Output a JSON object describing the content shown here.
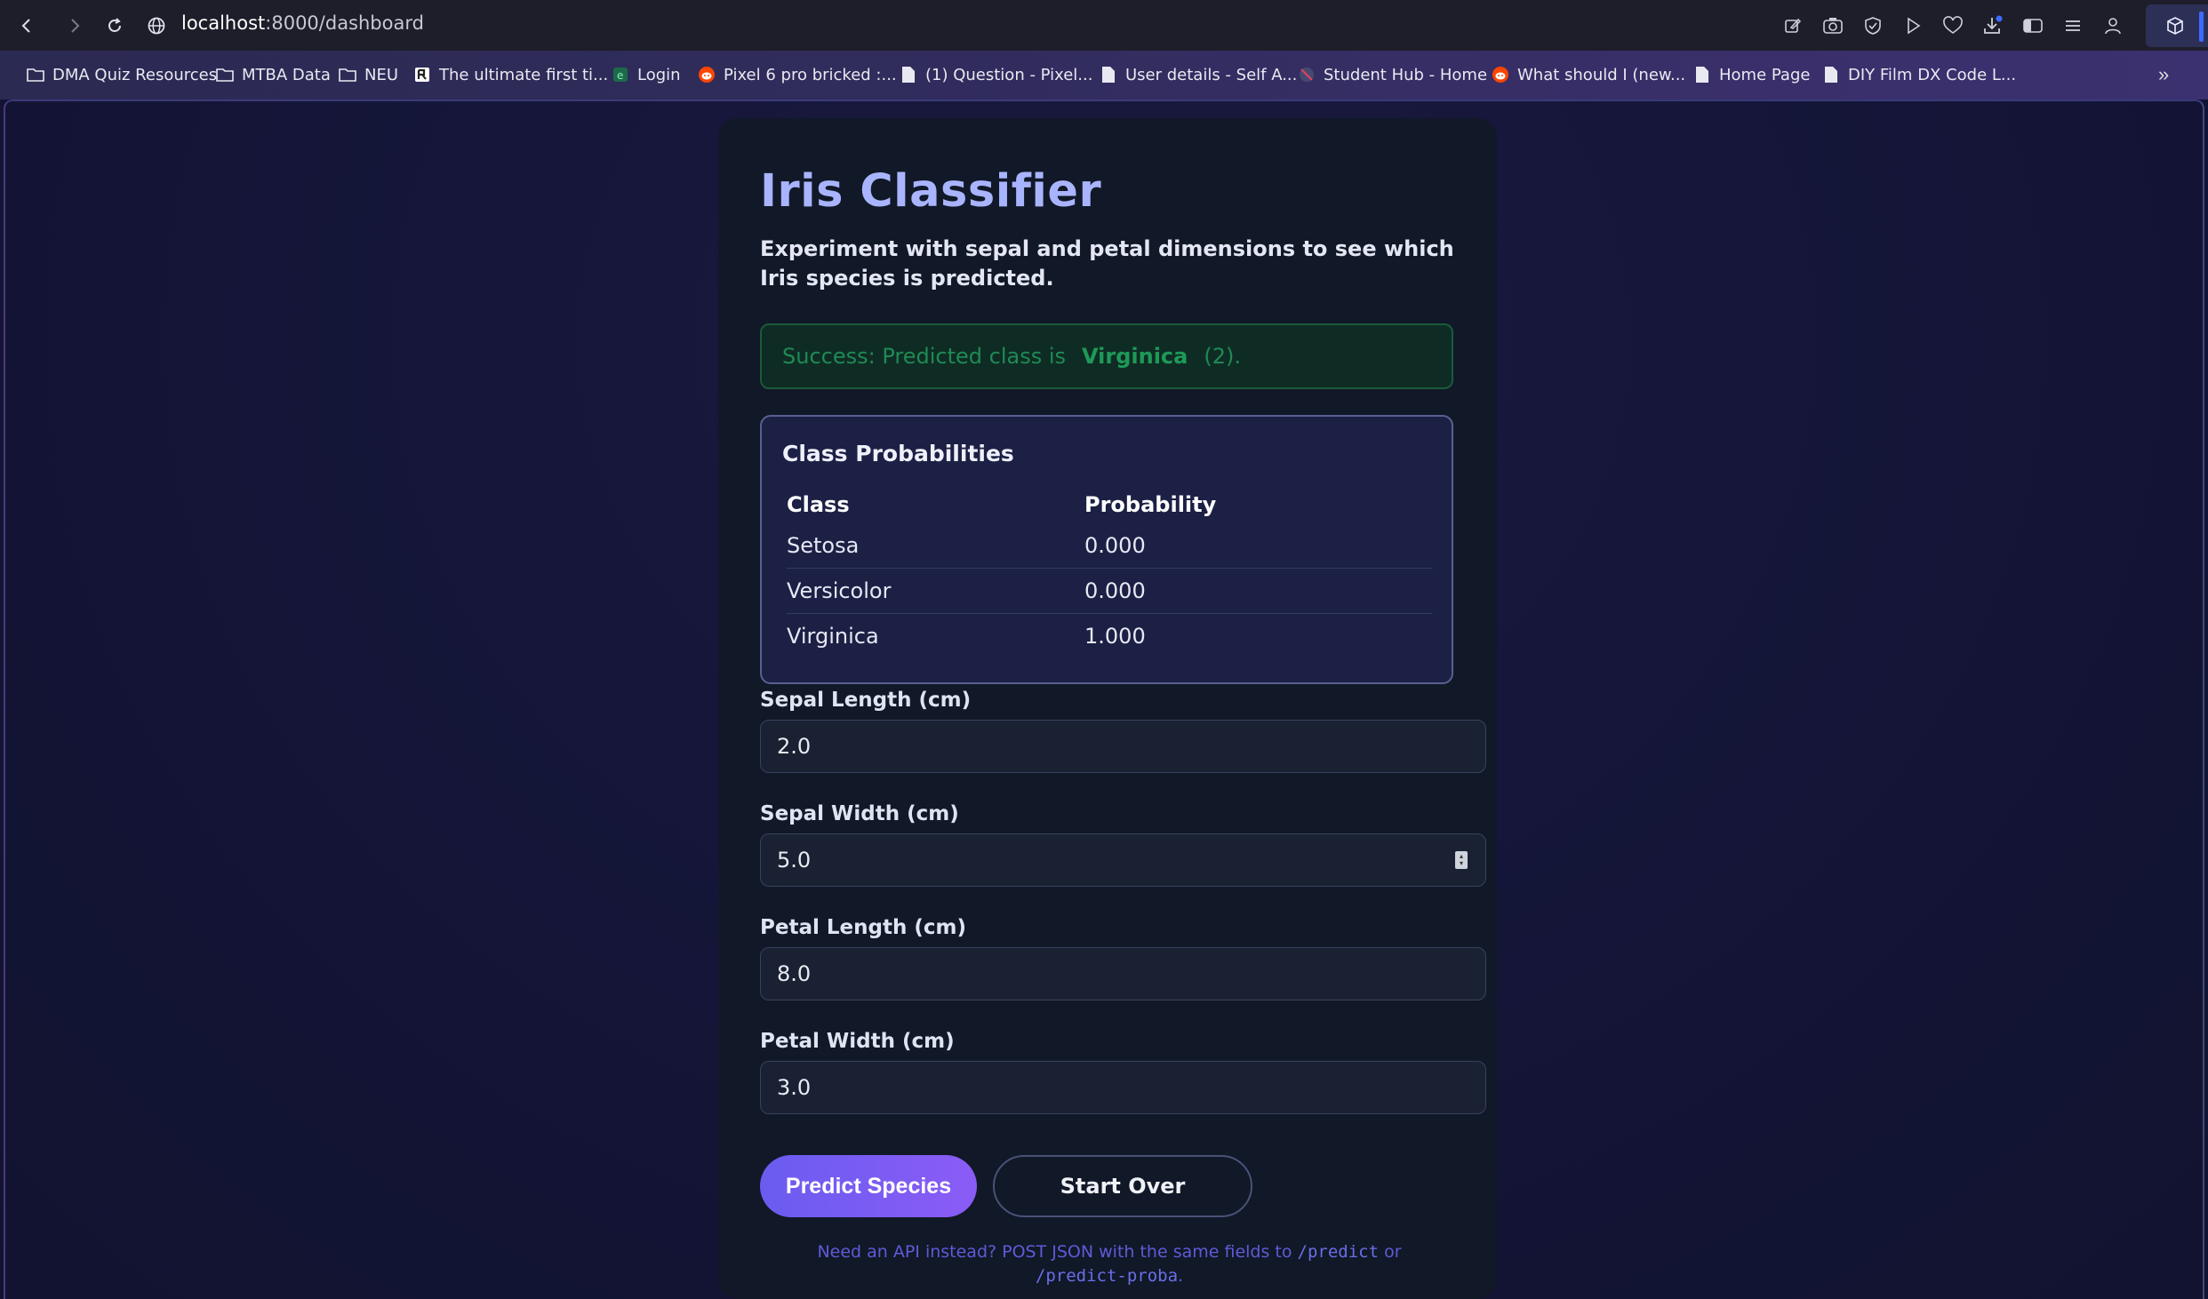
{
  "browser": {
    "url_host": "localhost",
    "url_path": ":8000/dashboard",
    "bookmarks": [
      {
        "label": "DMA Quiz Resources",
        "icon": "folder-icon"
      },
      {
        "label": "MTBA Data",
        "icon": "folder-icon"
      },
      {
        "label": "NEU",
        "icon": "folder-icon"
      },
      {
        "label": "The ultimate first ti...",
        "icon": "site-r-icon"
      },
      {
        "label": "Login",
        "icon": "site-g-icon"
      },
      {
        "label": "Pixel 6 pro bricked :...",
        "icon": "reddit-icon"
      },
      {
        "label": "(1) Question - Pixel...",
        "icon": "page-icon"
      },
      {
        "label": "User details - Self A...",
        "icon": "page-icon"
      },
      {
        "label": "Student Hub - Home",
        "icon": "blocked-icon"
      },
      {
        "label": "What should I (new...",
        "icon": "reddit-icon"
      },
      {
        "label": "Home Page",
        "icon": "page-icon"
      },
      {
        "label": "DIY Film DX Code L...",
        "icon": "page-icon"
      }
    ],
    "more_label": "»"
  },
  "app": {
    "title": "Iris Classifier",
    "subtitle": "Experiment with sepal and petal dimensions to see which Iris species is predicted.",
    "alert": {
      "prefix": "Success: Predicted class is",
      "class_name": "Virginica",
      "suffix": "(2)."
    },
    "probabilities": {
      "title": "Class Probabilities",
      "headers": [
        "Class",
        "Probability"
      ],
      "rows": [
        {
          "class": "Setosa",
          "probability": "0.000"
        },
        {
          "class": "Versicolor",
          "probability": "0.000"
        },
        {
          "class": "Virginica",
          "probability": "1.000"
        }
      ]
    },
    "fields": {
      "sepal_length": {
        "label": "Sepal Length (cm)",
        "value": "2.0"
      },
      "sepal_width": {
        "label": "Sepal Width (cm)",
        "value": "5.0"
      },
      "petal_length": {
        "label": "Petal Length (cm)",
        "value": "8.0"
      },
      "petal_width": {
        "label": "Petal Width (cm)",
        "value": "3.0"
      }
    },
    "buttons": {
      "predict": "Predict Species",
      "start_over": "Start Over"
    },
    "api_note": {
      "text1": "Need an API instead? POST JSON with the same fields to",
      "endpoint1": "/predict",
      "text2": "or",
      "endpoint2": "/predict-proba",
      "text3": "."
    }
  },
  "colors": {
    "accent": "#a9b4ff",
    "success": "#1f8a55",
    "button_gradient_start": "#6a5cf0",
    "button_gradient_end": "#8b5cf6"
  }
}
